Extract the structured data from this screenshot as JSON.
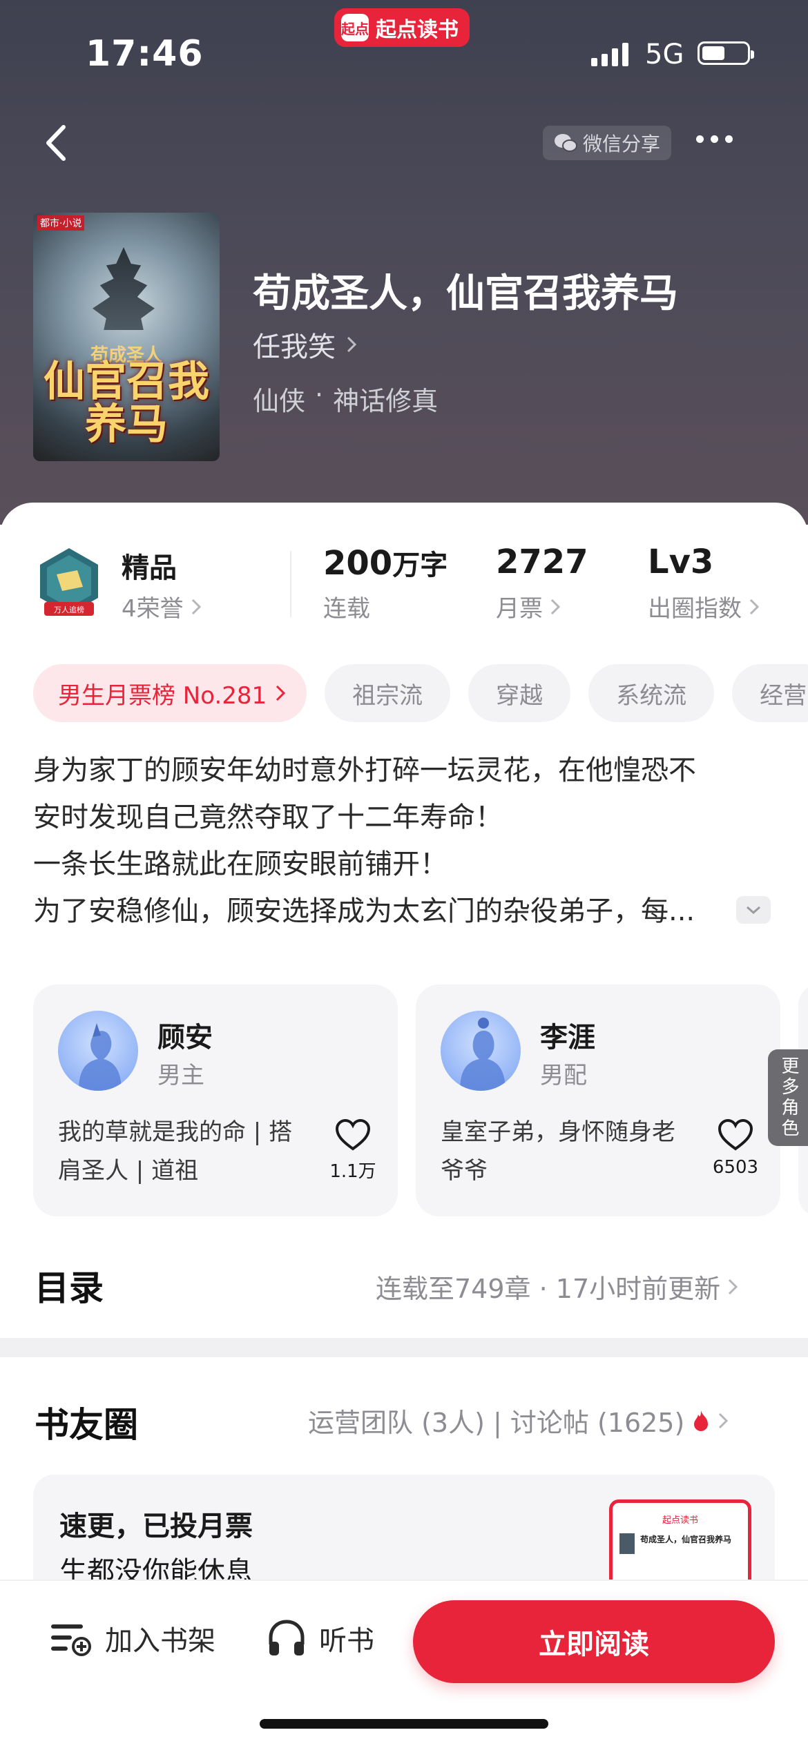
{
  "status_bar": {
    "time": "17:46",
    "network": "5G",
    "battery_level": 0.52
  },
  "app_badge": {
    "logo": "起点",
    "name": "起点读书"
  },
  "nav": {
    "share_label": "微信分享",
    "back_icon": "chevron-left-icon",
    "more_icon": "ellipsis-icon"
  },
  "book": {
    "cover": {
      "corner_tag": "都市·小说",
      "title_small": "苟成圣人",
      "title_large": "仙官召我养马"
    },
    "title": "苟成圣人，仙官召我养马",
    "author": "任我笑",
    "genre": "仙侠",
    "subgenre": "神话修真"
  },
  "stats": {
    "quality": {
      "value": "精品",
      "label": "4荣誉"
    },
    "words": {
      "value": "200",
      "unit": "万字",
      "label": "连载"
    },
    "monthly_votes": {
      "value": "2727",
      "label": "月票"
    },
    "circle_index": {
      "value": "Lv3",
      "label": "出圈指数"
    }
  },
  "tags": [
    "男生月票榜 No.281",
    "祖宗流",
    "穿越",
    "系统流",
    "经营"
  ],
  "synopsis": [
    "身为家丁的顾安年幼时意外打碎一坛灵花，在他惶恐不",
    "安时发现自己竟然夺取了十二年寿命！",
    "一条长生路就此在顾安眼前铺开！",
    "为了安稳修仙，顾安选择成为太玄门的杂役弟子，每..."
  ],
  "characters": [
    {
      "name": "顾安",
      "role": "男主",
      "desc": "我的草就是我的命 | 搭肩圣人 | 道祖",
      "likes": "1.1万"
    },
    {
      "name": "李涯",
      "role": "男配",
      "desc": "皇室子弟，身怀随身老爷爷",
      "likes": "6503"
    }
  ],
  "more_roles_label": "更多角色",
  "catalog": {
    "title": "目录",
    "meta": "连载至749章 · 17小时前更新"
  },
  "community": {
    "title": "书友圈",
    "meta": "运营团队 (3人) | 讨论帖 (1625)",
    "post": {
      "title": "速更，已投月票",
      "preview": "生都没你能休息",
      "thumb_header": "起点读书",
      "thumb_book": "苟成圣人，仙官召我养马"
    }
  },
  "bottom_bar": {
    "shelf_label": "加入书架",
    "listen_label": "听书",
    "read_label": "立即阅读"
  },
  "colors": {
    "accent": "#e8243a",
    "header_bg": "#45454f",
    "card_bg": "#f5f5f7",
    "muted": "#8c8c92"
  }
}
